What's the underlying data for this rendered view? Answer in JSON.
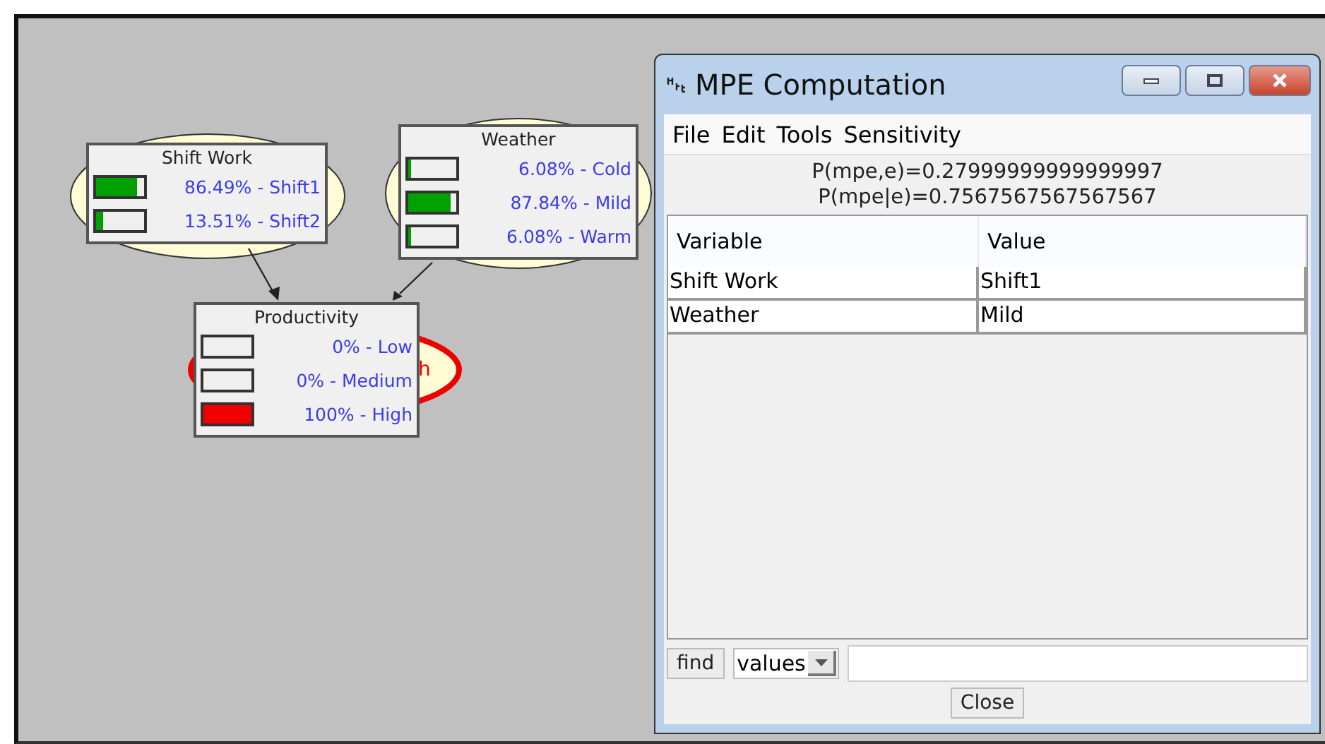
{
  "canvas": {
    "nodes": [
      {
        "title": "Shift Work",
        "evidence": false,
        "states": [
          {
            "label": "86.49% - Shift1",
            "level": 0.8649
          },
          {
            "label": "13.51% - Shift2",
            "level": 0.1351
          }
        ]
      },
      {
        "title": "Weather",
        "evidence": false,
        "states": [
          {
            "label": "6.08% - Cold",
            "level": 0.0608
          },
          {
            "label": "87.84% - Mild",
            "level": 0.8784
          },
          {
            "label": "6.08% - Warm",
            "level": 0.0608
          }
        ]
      },
      {
        "title": "Productivity",
        "evidence": true,
        "states": [
          {
            "label": "0% - Low",
            "level": 0
          },
          {
            "label": "0% - Medium",
            "level": 0
          },
          {
            "label": "100% - High",
            "level": 1
          }
        ]
      }
    ],
    "hidden_node_text": "h"
  },
  "dialog": {
    "title": "MPE Computation",
    "menu": [
      "File",
      "Edit",
      "Tools",
      "Sensitivity"
    ],
    "probabilities": [
      "P(mpe,e)=0.27999999999999997",
      "P(mpe|e)=0.7567567567567567"
    ],
    "table": {
      "columns": [
        "Variable",
        "Value"
      ],
      "rows": [
        [
          "Shift Work",
          "Shift1"
        ],
        [
          "Weather",
          "Mild"
        ]
      ]
    },
    "find_button": "find",
    "search_mode": "values",
    "close_button": "Close"
  }
}
